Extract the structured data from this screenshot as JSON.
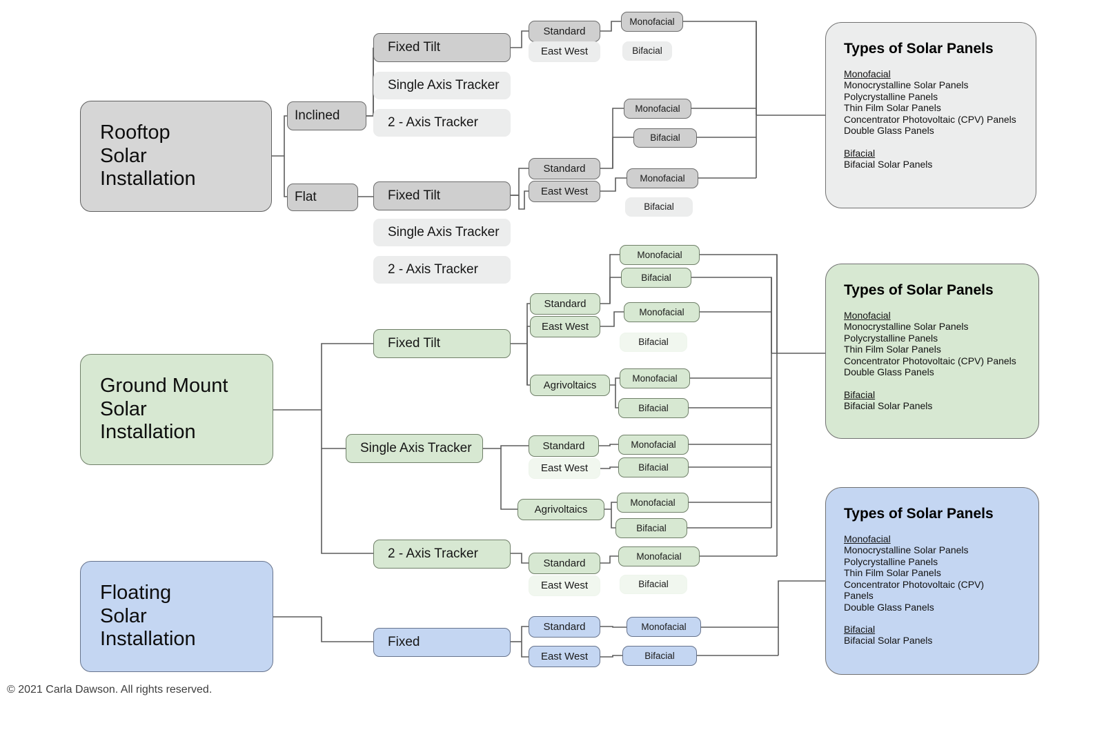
{
  "diagram": {
    "title": "Solar Installation Types Tree",
    "copyright": "© 2021 Carla Dawson. All rights reserved.",
    "colors": {
      "grey_fill": "#cfcfcf",
      "grey_panel": "#eceded",
      "green_fill": "#d7e8d2",
      "blue_fill": "#c4d6f2",
      "line": "#5c5c5c"
    }
  },
  "branches": {
    "rooftop": {
      "root": "Rooftop\nSolar\nInstallation",
      "root_lines": [
        "Rooftop",
        "Solar",
        "Installation"
      ],
      "mounts": [
        "Inclined",
        "Flat"
      ],
      "inclined": {
        "structures": [
          "Fixed Tilt",
          "Single Axis Tracker",
          "2 - Axis Tracker"
        ],
        "structures_enabled": [
          true,
          false,
          false
        ],
        "fixed_tilt": {
          "orientations": [
            "Standard",
            "East West"
          ],
          "orientations_enabled": [
            true,
            false
          ],
          "standard_panels": [
            "Monofacial",
            "Bifacial"
          ],
          "standard_panels_enabled": [
            true,
            false
          ]
        }
      },
      "flat": {
        "structures": [
          "Fixed Tilt",
          "Single Axis Tracker",
          "2 - Axis Tracker"
        ],
        "structures_enabled": [
          true,
          false,
          false
        ],
        "fixed_tilt": {
          "orientations": [
            "Standard",
            "East West"
          ],
          "orientations_enabled": [
            true,
            true
          ],
          "standard_panels": [
            "Monofacial",
            "Bifacial"
          ],
          "standard_panels_enabled": [
            true,
            true
          ],
          "eastwest_panels": [
            "Monofacial",
            "Bifacial"
          ],
          "eastwest_panels_enabled": [
            true,
            false
          ]
        }
      }
    },
    "ground": {
      "root_lines": [
        "Ground Mount",
        "Solar",
        "Installation"
      ],
      "structures": [
        "Fixed Tilt",
        "Single Axis Tracker",
        "2 - Axis Tracker"
      ],
      "fixed_tilt": {
        "orientations": [
          "Standard",
          "East West",
          "Agrivoltaics"
        ],
        "orientations_enabled": [
          true,
          true,
          true
        ],
        "standard_panels": [
          "Monofacial",
          "Bifacial"
        ],
        "standard_panels_enabled": [
          true,
          true
        ],
        "eastwest_panels": [
          "Monofacial",
          "Bifacial"
        ],
        "eastwest_panels_enabled": [
          true,
          false
        ],
        "agrivoltaics_panels": [
          "Monofacial",
          "Bifacial"
        ],
        "agrivoltaics_panels_enabled": [
          true,
          true
        ]
      },
      "single_axis": {
        "orientations": [
          "Standard",
          "East West",
          "Agrivoltaics"
        ],
        "orientations_enabled": [
          true,
          false,
          true
        ],
        "standard_panels": [
          "Monofacial",
          "Bifacial"
        ],
        "standard_panels_enabled": [
          true,
          true
        ],
        "agrivoltaics_panels": [
          "Monofacial",
          "Bifacial"
        ],
        "agrivoltaics_panels_enabled": [
          true,
          true
        ]
      },
      "two_axis": {
        "orientations": [
          "Standard",
          "East West"
        ],
        "orientations_enabled": [
          true,
          false
        ],
        "standard_panels": [
          "Monofacial",
          "Bifacial"
        ],
        "standard_panels_enabled": [
          true,
          false
        ]
      }
    },
    "floating": {
      "root_lines": [
        "Floating",
        "Solar",
        "Installation"
      ],
      "structures": [
        "Fixed"
      ],
      "fixed": {
        "orientations": [
          "Standard",
          "East West"
        ],
        "orientations_enabled": [
          true,
          true
        ],
        "standard_panels": [
          "Monofacial"
        ],
        "eastwest_panels": [
          "Bifacial"
        ]
      }
    }
  },
  "panels": {
    "grey": {
      "title": "Types of Solar Panels",
      "mono_header": "Monofacial",
      "mono_items": [
        "Monocrystalline Solar Panels",
        "Polycrystalline Panels",
        "Thin Film Solar Panels",
        "Concentrator Photovoltaic (CPV) Panels",
        "Double Glass Panels"
      ],
      "bi_header": "Bifacial",
      "bi_items": [
        "Bifacial Solar Panels"
      ]
    },
    "green": {
      "title": "Types of Solar Panels",
      "mono_header": "Monofacial",
      "mono_items": [
        "Monocrystalline Solar Panels",
        "Polycrystalline Panels",
        "Thin Film Solar Panels",
        "Concentrator Photovoltaic (CPV) Panels",
        "Double Glass Panels"
      ],
      "bi_header": "Bifacial",
      "bi_items": [
        "Bifacial Solar Panels"
      ]
    },
    "blue": {
      "title": "Types of Solar Panels",
      "mono_header": "Monofacial",
      "mono_items": [
        "Monocrystalline Solar Panels",
        "Polycrystalline Panels",
        "Thin Film Solar Panels",
        "Concentrator Photovoltaic (CPV)",
        "Panels",
        "Double Glass Panels"
      ],
      "bi_header": "Bifacial",
      "bi_items": [
        "Bifacial Solar Panels"
      ]
    }
  }
}
